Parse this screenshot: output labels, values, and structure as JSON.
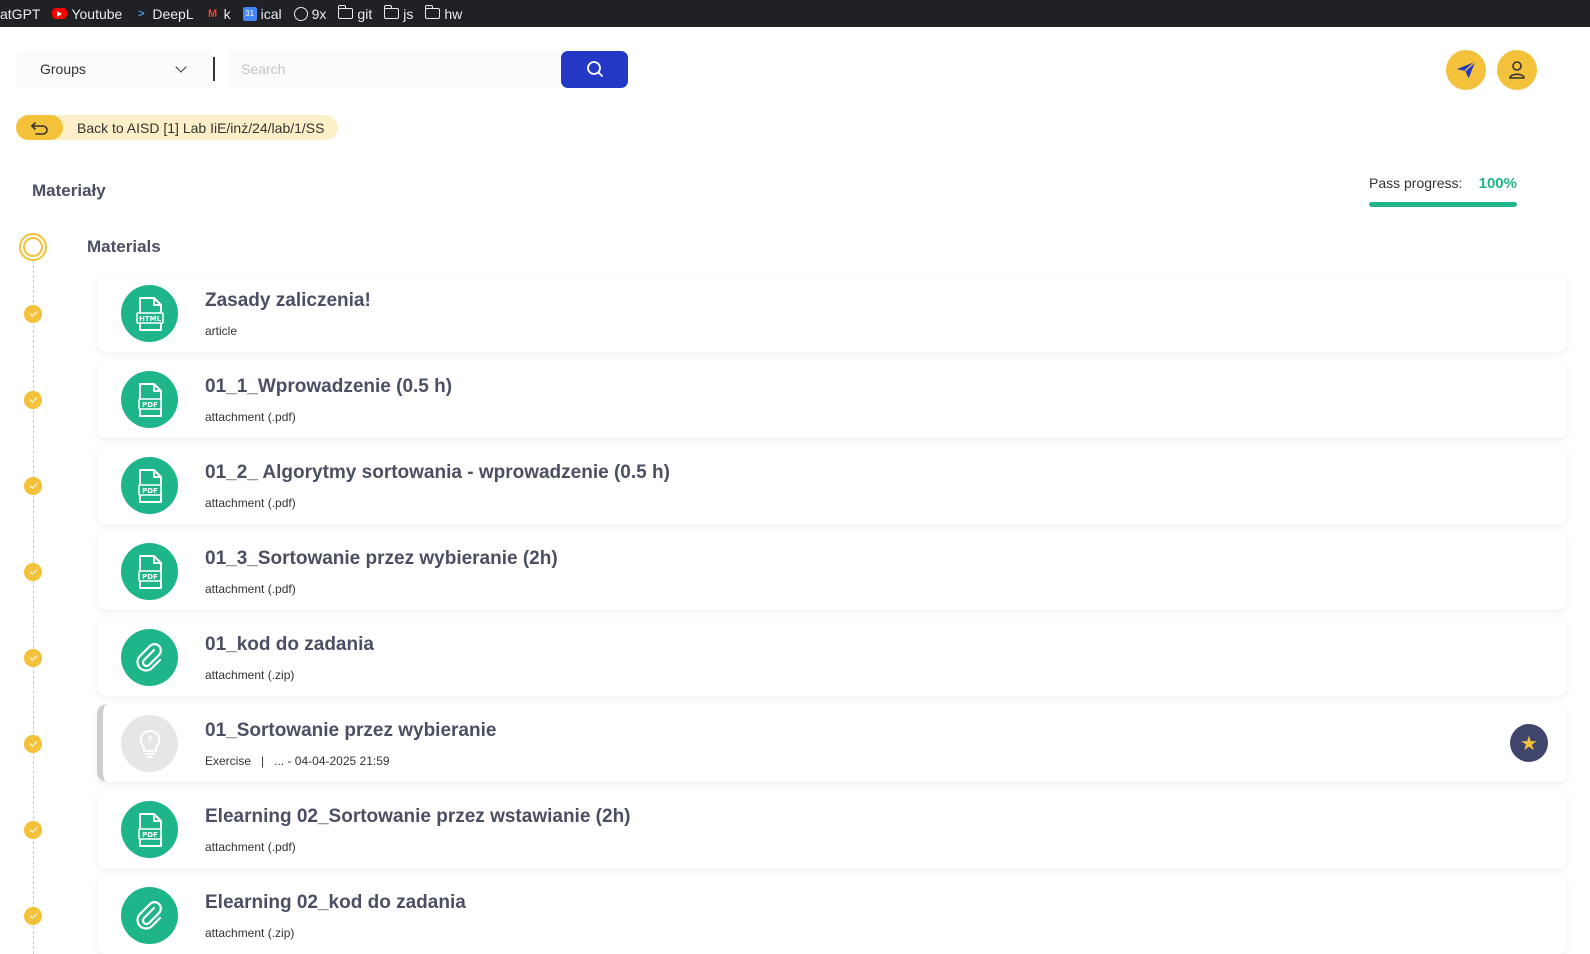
{
  "bookmarks": [
    {
      "label": "atGPT",
      "icon": "chatgpt-icon"
    },
    {
      "label": "Youtube",
      "icon": "youtube-icon"
    },
    {
      "label": "DeepL",
      "icon": "deepl-icon"
    },
    {
      "label": "k",
      "icon": "gmail-icon"
    },
    {
      "label": "ical",
      "icon": "calendar-icon"
    },
    {
      "label": "9x",
      "icon": "globe-icon"
    },
    {
      "label": "git",
      "icon": "folder-icon"
    },
    {
      "label": "js",
      "icon": "folder-icon"
    },
    {
      "label": "hw",
      "icon": "folder-icon"
    }
  ],
  "header": {
    "groups_label": "Groups",
    "search_placeholder": "Search",
    "search_icon": "search-icon",
    "send_icon": "paper-plane-icon",
    "user_icon": "user-icon"
  },
  "back": {
    "label": "Back to AISD [1] Lab IiE/inż/24/lab/1/SS",
    "icon": "undo-arrow-icon"
  },
  "section": {
    "title": "Materiały",
    "progress_label": "Pass progress:",
    "progress_value": "100%",
    "progress_fraction": 1.0
  },
  "group": {
    "title": "Materials"
  },
  "items": [
    {
      "title": "Zasady zaliczenia!",
      "subtitle": "article",
      "icon": "html-file-icon"
    },
    {
      "title": "01_1_Wprowadzenie (0.5 h)",
      "subtitle": "attachment (.pdf)",
      "icon": "pdf-file-icon"
    },
    {
      "title": "01_2_ Algorytmy sortowania - wprowadzenie (0.5 h)",
      "subtitle": "attachment (.pdf)",
      "icon": "pdf-file-icon"
    },
    {
      "title": "01_3_Sortowanie przez wybieranie (2h)",
      "subtitle": "attachment (.pdf)",
      "icon": "pdf-file-icon"
    },
    {
      "title": "01_kod do zadania",
      "subtitle": "attachment (.zip)",
      "icon": "paperclip-icon"
    },
    {
      "title": "01_Sortowanie przez wybieranie",
      "subtitle": "Exercise   |   ... - 04-04-2025 21:59",
      "icon": "lightbulb-icon"
    },
    {
      "title": "Elearning 02_Sortowanie przez wstawianie (2h)",
      "subtitle": "attachment (.pdf)",
      "icon": "pdf-file-icon"
    },
    {
      "title": "Elearning 02_kod do zadania",
      "subtitle": "attachment (.zip)",
      "icon": "paperclip-icon"
    }
  ],
  "colors": {
    "accent_green": "#1fb58a",
    "accent_yellow": "#f3c13a",
    "search_blue": "#2338c4",
    "text_dark": "#4b4f63"
  }
}
